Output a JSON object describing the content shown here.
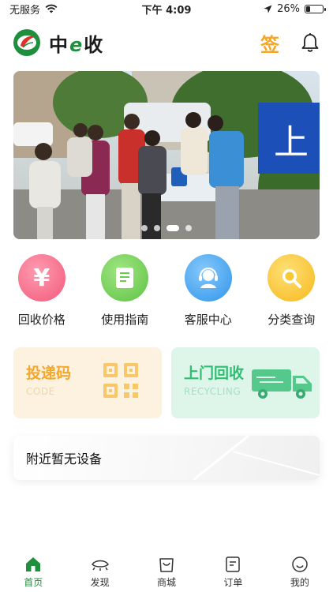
{
  "status_bar": {
    "carrier": "无服务",
    "time": "下午 4:09",
    "battery": "26%",
    "battery_level": 0.26
  },
  "header": {
    "app_name": "中e收",
    "app_name_parts": [
      "中",
      "e",
      "收"
    ],
    "sign_label": "签"
  },
  "banner": {
    "slides": 4,
    "active_slide": 2,
    "sign_text": "上"
  },
  "shortcuts": [
    {
      "label": "回收价格",
      "icon": "yen-icon",
      "color": "#f46a86"
    },
    {
      "label": "使用指南",
      "icon": "guide-book-icon",
      "color": "#72d15a"
    },
    {
      "label": "客服中心",
      "icon": "customer-service-icon",
      "color": "#3fa4ef"
    },
    {
      "label": "分类查询",
      "icon": "search-icon",
      "color": "#f7c22c"
    }
  ],
  "cards": {
    "code": {
      "title": "投递码",
      "subtitle": "CODE",
      "icon": "qr-code-icon"
    },
    "recycle": {
      "title": "上门回收",
      "subtitle": "RECYCLING",
      "icon": "truck-icon"
    }
  },
  "nearby": {
    "text": "附近暂无设备"
  },
  "tabbar": [
    {
      "label": "首页",
      "icon": "home-icon",
      "active": true
    },
    {
      "label": "发现",
      "icon": "eye-icon",
      "active": false
    },
    {
      "label": "商城",
      "icon": "shopping-bag-icon",
      "active": false
    },
    {
      "label": "订单",
      "icon": "order-icon",
      "active": false
    },
    {
      "label": "我的",
      "icon": "smile-icon",
      "active": false
    }
  ],
  "colors": {
    "brand_green": "#1f8f3e",
    "accent_orange": "#f5a623"
  }
}
